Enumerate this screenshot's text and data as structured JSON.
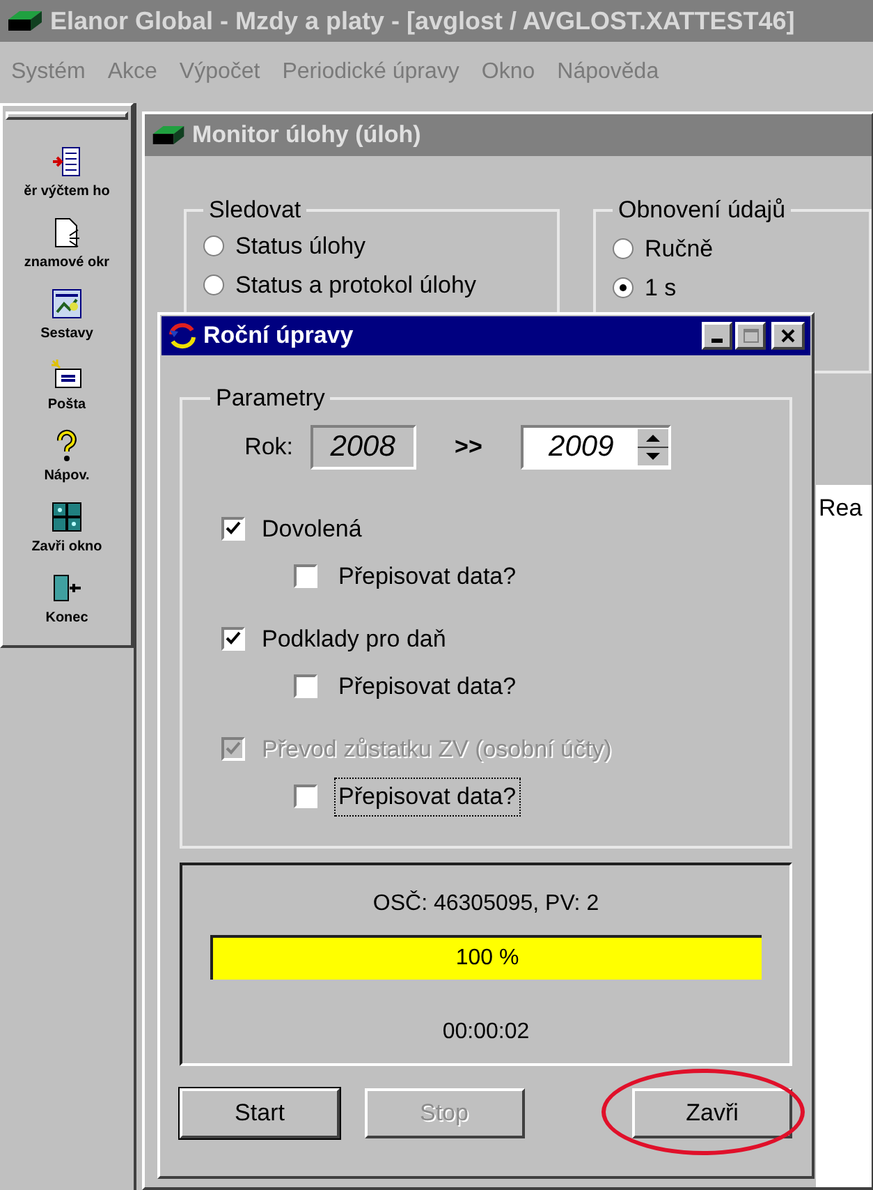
{
  "app_window": {
    "title": "Elanor Global - Mzdy a platy - [avglost / AVGLOST.XATTEST46]"
  },
  "menu": [
    "Systém",
    "Akce",
    "Výpočet",
    "Periodické úpravy",
    "Okno",
    "Nápověda"
  ],
  "toolbar": [
    {
      "kind": "list",
      "label": "ěr výčtem ho"
    },
    {
      "kind": "document",
      "label": "znamové okr"
    },
    {
      "kind": "report",
      "label": "Sestavy"
    },
    {
      "kind": "mail",
      "label": "Pošta"
    },
    {
      "kind": "help",
      "label": "Nápov."
    },
    {
      "kind": "window",
      "label": "Zavři okno"
    },
    {
      "kind": "exit",
      "label": "Konec"
    }
  ],
  "monitor_window": {
    "title": "Monitor úlohy (úloh)",
    "watch_group": {
      "label": "Sledovat",
      "options": [
        {
          "label": "Status úlohy",
          "selected": false
        },
        {
          "label": "Status a protokol úlohy",
          "selected": false
        }
      ]
    },
    "refresh_group": {
      "label": "Obnovení údajů",
      "options": [
        {
          "label": "Ručně",
          "selected": false
        },
        {
          "label": "1 s",
          "selected": true
        }
      ]
    },
    "list_header": "Rea"
  },
  "dialog": {
    "title": "Roční úpravy",
    "group_label": "Parametry",
    "year_label": "Rok:",
    "year_from": "2008",
    "year_arrow": ">>",
    "year_to": "2009",
    "options": [
      {
        "label": "Dovolená",
        "checked": true,
        "disabled": false,
        "overwrite": {
          "label": "Přepisovat data?",
          "checked": false,
          "focused": false
        }
      },
      {
        "label": "Podklady pro daň",
        "checked": true,
        "disabled": false,
        "overwrite": {
          "label": "Přepisovat data?",
          "checked": false,
          "focused": false
        }
      },
      {
        "label": "Převod zůstatku ZV (osobní účty)",
        "checked": true,
        "disabled": true,
        "overwrite": {
          "label": "Přepisovat data?",
          "checked": false,
          "focused": true
        }
      }
    ],
    "status": "OSČ: 46305095, PV: 2",
    "progress": {
      "level": 1,
      "text": "100 %"
    },
    "elapsed": "00:00:02",
    "buttons": [
      {
        "label": "Start",
        "default": true,
        "disabled": false,
        "highlighted": false
      },
      {
        "label": "Stop",
        "default": false,
        "disabled": true,
        "highlighted": false
      },
      {
        "label": "Zavři",
        "default": false,
        "disabled": false,
        "highlighted": true
      }
    ]
  }
}
